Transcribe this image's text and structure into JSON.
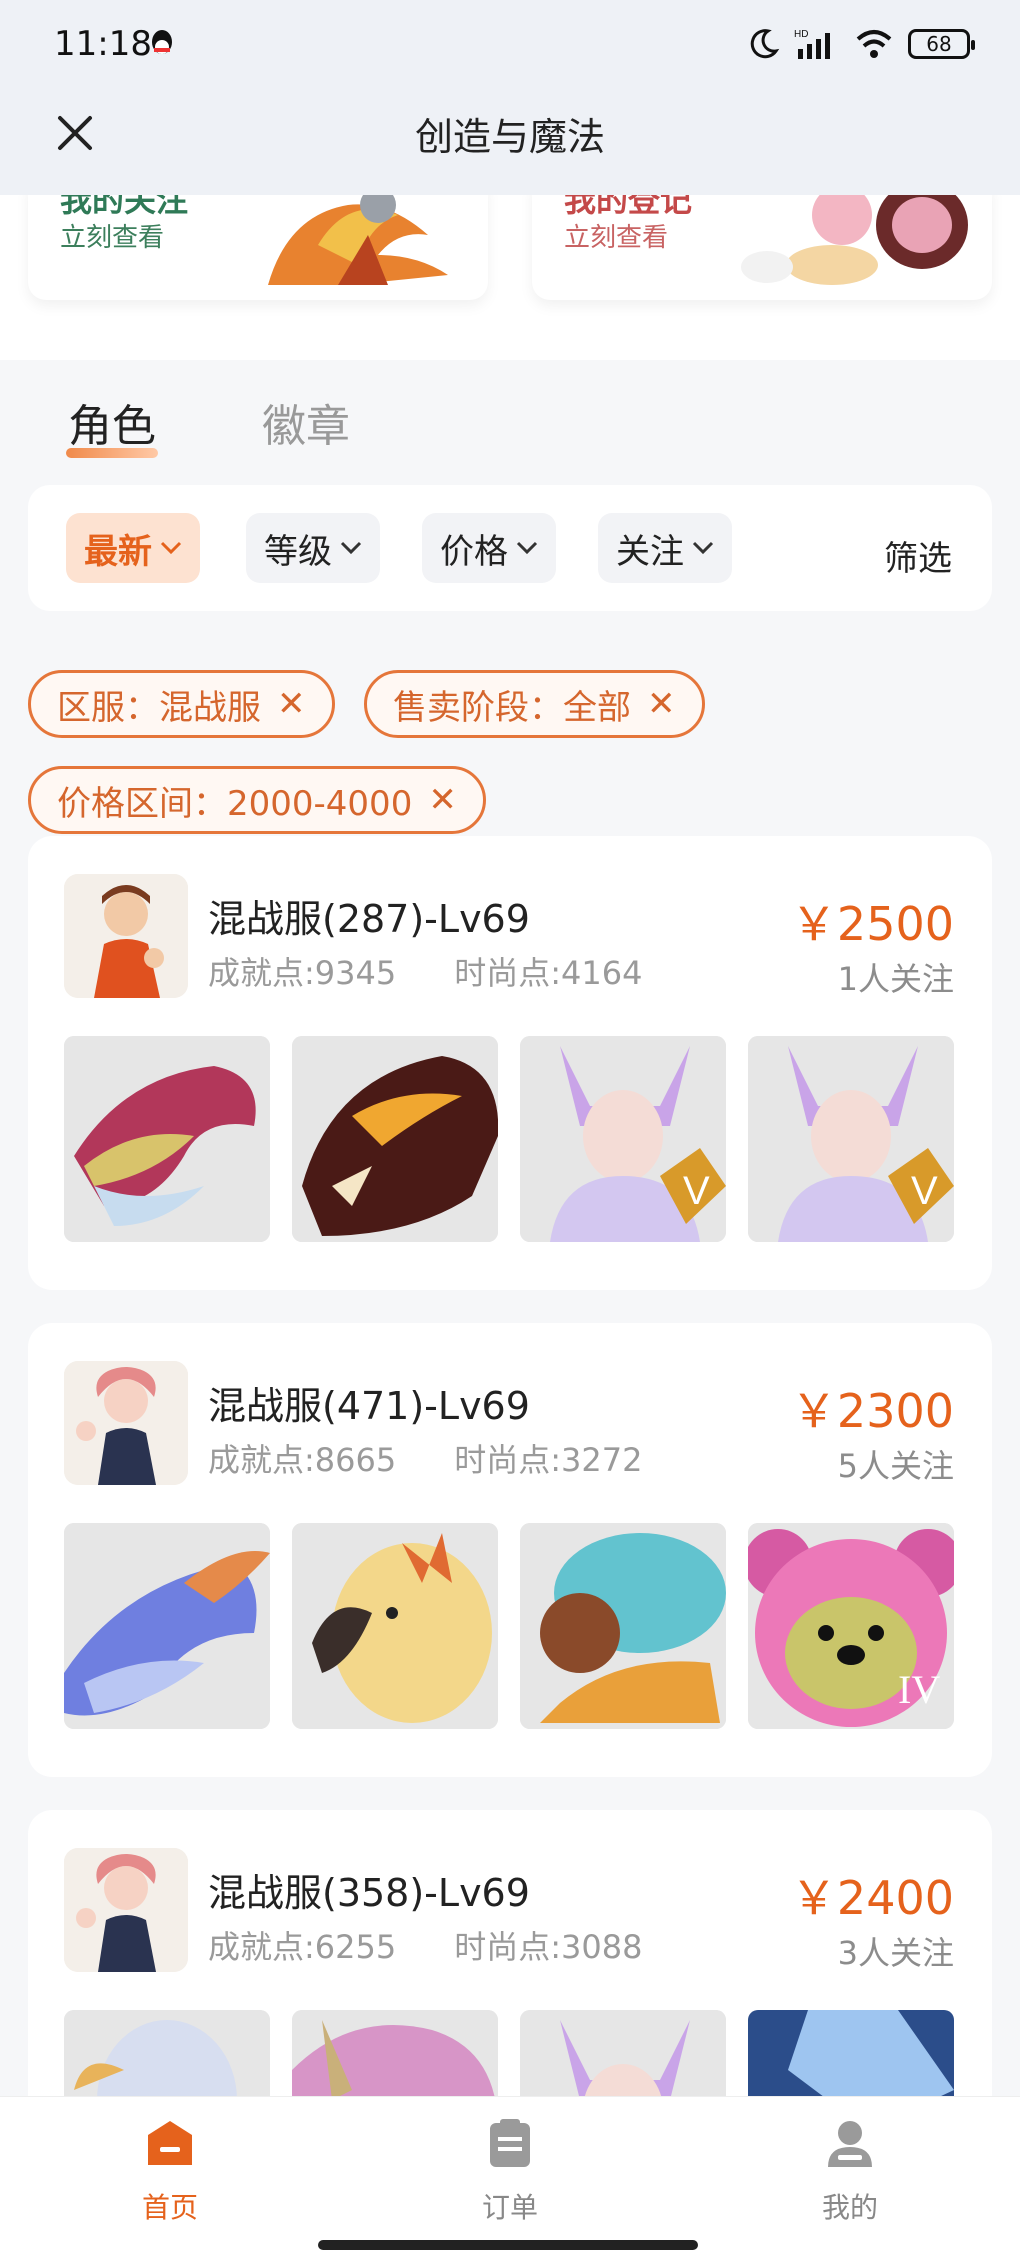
{
  "status": {
    "time": "11:18",
    "battery": "68"
  },
  "header": {
    "title": "创造与魔法"
  },
  "top_cards": [
    {
      "heading": "我的关注",
      "sub": "立刻查看"
    },
    {
      "heading": "我的登记",
      "sub": "立刻查看"
    }
  ],
  "tabs": [
    {
      "label": "角色",
      "active": true
    },
    {
      "label": "徽章",
      "active": false
    }
  ],
  "filters": {
    "chips": [
      "最新",
      "等级",
      "价格",
      "关注"
    ],
    "filter_label": "筛选"
  },
  "tags": [
    "区服：混战服",
    "售卖阶段：全部",
    "价格区间：2000-4000"
  ],
  "listings": [
    {
      "server": "混战服(287)-Lv69",
      "achievement": "成就点:9345",
      "fashion": "时尚点:4164",
      "price": "￥2500",
      "follows": "1人关注"
    },
    {
      "server": "混战服(471)-Lv69",
      "achievement": "成就点:8665",
      "fashion": "时尚点:3272",
      "price": "￥2300",
      "follows": "5人关注"
    },
    {
      "server": "混战服(358)-Lv69",
      "achievement": "成就点:6255",
      "fashion": "时尚点:3088",
      "price": "￥2400",
      "follows": "3人关注"
    }
  ],
  "thumb_badges": {
    "v": "V",
    "iv": "IV"
  },
  "bottom_nav": [
    {
      "label": "首页",
      "active": true
    },
    {
      "label": "订单",
      "active": false
    },
    {
      "label": "我的",
      "active": false
    }
  ],
  "colors": {
    "accent": "#e5621c",
    "tag_border": "#e5763a",
    "bg": "#f6f7f9"
  }
}
